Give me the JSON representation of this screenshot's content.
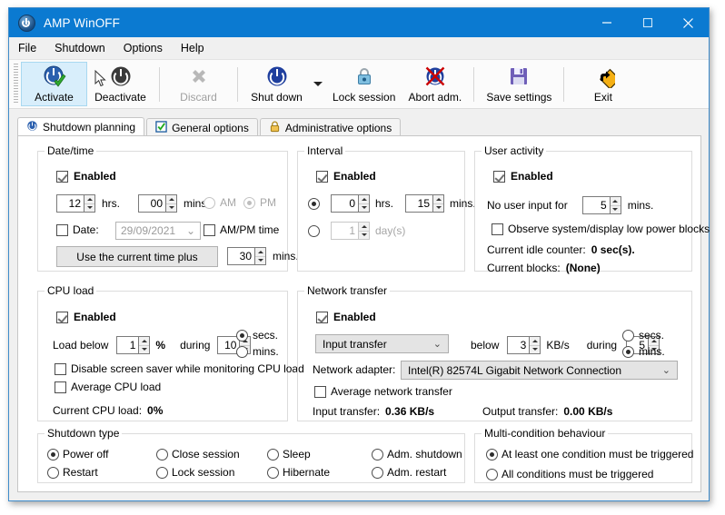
{
  "window": {
    "title": "AMP WinOFF",
    "icon": "power-icon",
    "controls": {
      "minimize": "minimize-icon",
      "maximize": "maximize-icon",
      "close": "close-icon"
    }
  },
  "menu": {
    "items": [
      "File",
      "Shutdown",
      "Options",
      "Help"
    ]
  },
  "toolbar": {
    "buttons": [
      {
        "label": "Activate",
        "icon": "activate-power-check-icon",
        "state": "selected"
      },
      {
        "label": "Deactivate",
        "icon": "power-dark-icon",
        "state": "normal"
      },
      {
        "label": "Discard",
        "icon": "x-cross-icon",
        "state": "disabled"
      },
      {
        "label": "Shut down",
        "icon": "power-blue-icon",
        "state": "normal"
      },
      {
        "label": "Lock session",
        "icon": "padlock-icon",
        "state": "normal"
      },
      {
        "label": "Abort adm.",
        "icon": "abort-circle-slash-icon",
        "state": "normal"
      },
      {
        "label": "Save settings",
        "icon": "floppy-disk-icon",
        "state": "normal"
      },
      {
        "label": "Exit",
        "icon": "exit-arrow-sign-icon",
        "state": "normal"
      }
    ],
    "dropdown_icon": "chevron-down-icon"
  },
  "tabs": [
    {
      "label": "Shutdown planning",
      "icon": "power-icon",
      "active": true
    },
    {
      "label": "General options",
      "icon": "checkbox-icon",
      "active": false
    },
    {
      "label": "Administrative options",
      "icon": "lock-icon",
      "active": false
    }
  ],
  "datetime": {
    "caption": "Date/time",
    "enabled_label": "Enabled",
    "hours_value": "12",
    "hours_label": "hrs.",
    "mins_value": "00",
    "mins_label": "mins.",
    "am_label": "AM",
    "pm_label": "PM",
    "date_checkbox_label": "Date:",
    "date_value": "29/09/2021",
    "ampm_time_label": "AM/PM time",
    "use_current_button": "Use the current time plus",
    "plus_value": "30",
    "plus_units": "mins."
  },
  "interval": {
    "caption": "Interval",
    "enabled_label": "Enabled",
    "hours_value": "0",
    "hours_label": "hrs.",
    "mins_value": "15",
    "mins_label": "mins.",
    "days_value": "1",
    "days_label": "day(s)"
  },
  "user_activity": {
    "caption": "User activity",
    "enabled_label": "Enabled",
    "no_input_label": "No user input for",
    "no_input_value": "5",
    "no_input_units": "mins.",
    "observe_label": "Observe system/display low power blocks",
    "idle_counter_label": "Current idle counter:",
    "idle_counter_value": "0 sec(s).",
    "blocks_label": "Current blocks:",
    "blocks_value": "(None)"
  },
  "cpu_load": {
    "caption": "CPU load",
    "enabled_label": "Enabled",
    "load_below_label": "Load below",
    "load_below_value": "1",
    "percent_label": "%",
    "during_label": "during",
    "during_value": "10",
    "secs_label": "secs.",
    "mins_label": "mins.",
    "disable_saver_label": "Disable screen saver while monitoring CPU load",
    "average_label": "Average CPU load",
    "current_label": "Current CPU load:",
    "current_value": "0%"
  },
  "network": {
    "caption": "Network transfer",
    "enabled_label": "Enabled",
    "transfer_type": "Input transfer",
    "below_label": "below",
    "below_value": "3",
    "below_units": "KB/s",
    "during_label": "during",
    "during_value": "5",
    "secs_label": "secs.",
    "mins_label": "mins.",
    "adapter_label": "Network adapter:",
    "adapter_value": "Intel(R) 82574L Gigabit Network Connection",
    "average_label": "Average network transfer",
    "input_label": "Input transfer:",
    "input_value": "0.36 KB/s",
    "output_label": "Output transfer:",
    "output_value": "0.00 KB/s"
  },
  "shutdown_type": {
    "caption": "Shutdown type",
    "options": [
      "Power off",
      "Close session",
      "Sleep",
      "Adm. shutdown",
      "Restart",
      "Lock session",
      "Hibernate",
      "Adm. restart"
    ],
    "selected": "Power off"
  },
  "multi_condition": {
    "caption": "Multi-condition behaviour",
    "options": [
      "At least one condition must be triggered",
      "All conditions must be triggered"
    ],
    "selected": "At least one condition must be triggered"
  },
  "colors": {
    "titlebar": "#0b7ad1",
    "accent": "#2b5fa8",
    "tab_active": "#ffffff"
  }
}
